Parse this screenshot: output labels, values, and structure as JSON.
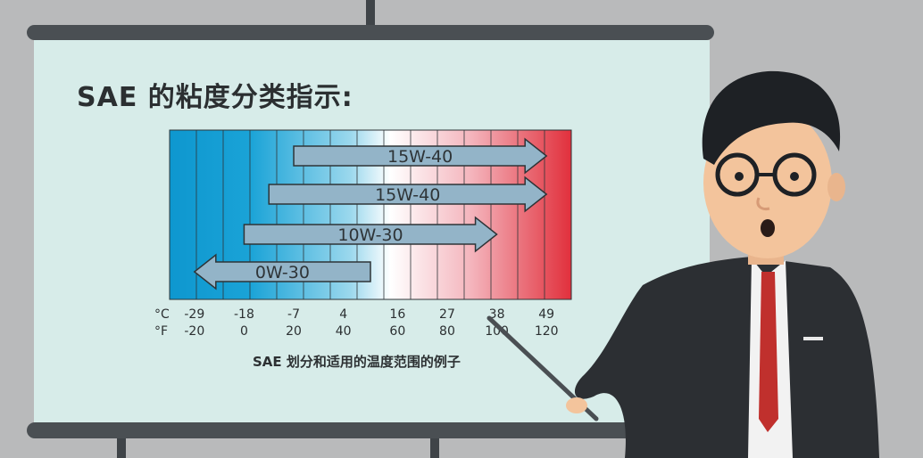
{
  "title": "SAE 的粘度分类指示:",
  "caption": "SAE 划分和适用的温度范围的例子",
  "units": {
    "celsius": "°C",
    "fahrenheit": "°F"
  },
  "celsius_ticks": [
    "-29",
    "-18",
    "-7",
    "4",
    "16",
    "27",
    "38",
    "49"
  ],
  "fahrenheit_ticks": [
    "-20",
    "0",
    "20",
    "40",
    "60",
    "80",
    "100",
    "120"
  ],
  "arrows": [
    {
      "label": "15W-40",
      "from": -7,
      "to": 49,
      "direction": "right"
    },
    {
      "label": "15W-40",
      "from": -12.5,
      "to": 49,
      "direction": "right"
    },
    {
      "label": "10W-30",
      "from": -18,
      "to": 38,
      "direction": "right"
    },
    {
      "label": "0W-30",
      "from": -29,
      "to": 10,
      "direction": "left"
    }
  ],
  "colors": {
    "cold": "#0e97cf",
    "neutral": "#ffffff",
    "hot": "#e1303c",
    "arrow_fill": "#93b4c8",
    "board": "#d7ece9",
    "frame": "#4a4f53"
  }
}
